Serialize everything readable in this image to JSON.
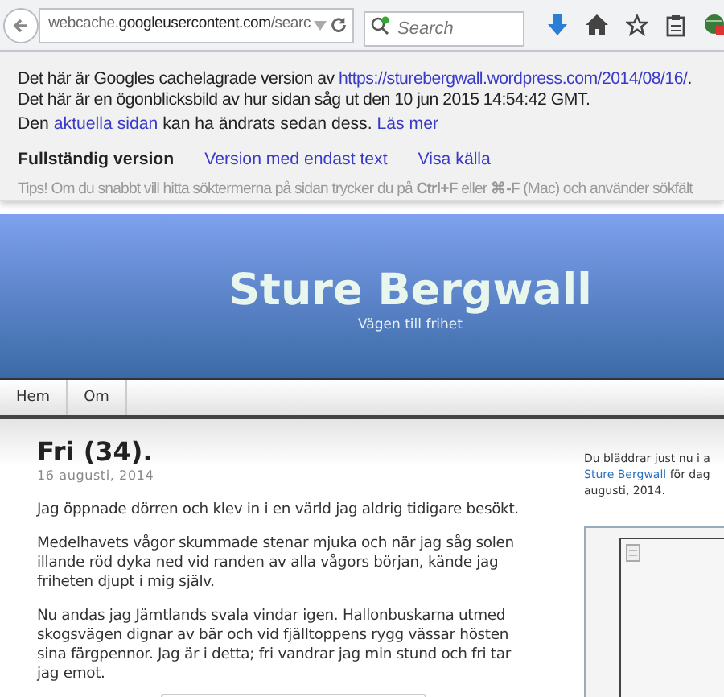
{
  "toolbar": {
    "url": {
      "host_prefix": "webcache.",
      "host": "googleusercontent.com",
      "path": "/searc"
    },
    "search": {
      "placeholder": "Search"
    }
  },
  "cache_banner": {
    "line1": "Det här är Googles cachelagrade version av ",
    "link": "https://sturebergwall.wordpress.com/2014/08/16/",
    "line1_rest": ". Det här är en ögonblicksbild av hur sidan såg ut den 10 jun 2015 14:54:42 GMT.",
    "line2_start": "Den ",
    "line2_link": "aktuella sidan",
    "line2_rest": " kan ha ändrats sedan dess. ",
    "more_link": "Läs mer",
    "versions": [
      {
        "label": "Fullständig version",
        "selected": true
      },
      {
        "label": "Version med endast text",
        "selected": false
      },
      {
        "label": "Visa källa",
        "selected": false
      }
    ],
    "tip": "Tips! Om du snabbt vill hitta söktermerna på sidan trycker du på **Ctrl+F** eller **⌘-F** (Mac) och använder sökfält"
  },
  "site": {
    "title": "Sture Bergwall",
    "tagline": "Vägen till frihet"
  },
  "nav": [
    {
      "label": "Hem"
    },
    {
      "label": "Om"
    }
  ],
  "post": {
    "title": "Fri (34).",
    "date": "16 augusti, 2014",
    "paragraphs": [
      "Jag öppnade dörren och klev in i en värld jag aldrig tidigare besökt.",
      "Medelhavets vågor skummade stenar mjuka och när jag såg solen illande röd dyka ned vid randen av alla vågors början, kände jag friheten djupt i mig själv.",
      "Nu andas jag Jämtlands svala vindar igen. Hallonbuskarna utmed skogsvägen dignar av bär och vid  fjälltoppens rygg vässar hösten sina färgpennor. Jag är i detta; fri vandrar jag min stund och fri tar jag emot."
    ]
  },
  "sidebar": {
    "line1": "Du bläddrar just nu i a",
    "link": "Sture Bergwall",
    "link_rest": " för dag",
    "line3": "augusti, 2014."
  }
}
